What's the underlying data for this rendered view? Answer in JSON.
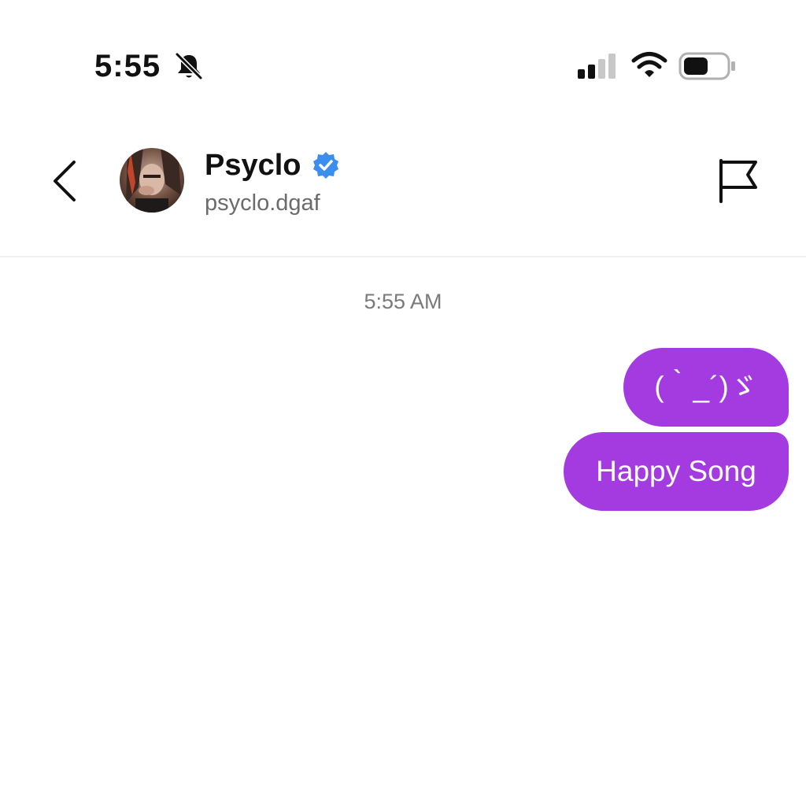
{
  "status_bar": {
    "time": "5:55",
    "icons": [
      "bell-muted-icon",
      "cellular-signal-icon",
      "wifi-icon",
      "battery-icon"
    ]
  },
  "header": {
    "back_icon": "chevron-left-icon",
    "contact_name": "Psyclo",
    "contact_handle": "psyclo.dgaf",
    "verified_icon": "verified-badge-icon",
    "report_icon": "flag-icon"
  },
  "conversation": {
    "timestamp": "5:55 AM",
    "messages": [
      {
        "text": "(｀_´)ゞ",
        "direction": "outgoing"
      },
      {
        "text": "Happy Song",
        "direction": "outgoing"
      }
    ]
  },
  "colors": {
    "bubble": "#a43be0",
    "verified": "#3b8ef0",
    "text_primary": "#111111",
    "text_secondary": "#6b6b6b"
  }
}
